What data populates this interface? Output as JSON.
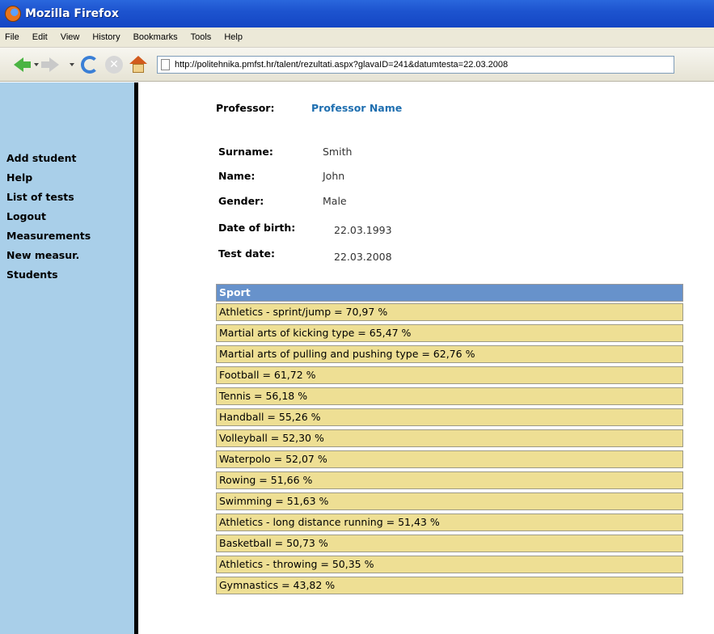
{
  "window": {
    "title": "Mozilla Firefox"
  },
  "menu": [
    "File",
    "Edit",
    "View",
    "History",
    "Bookmarks",
    "Tools",
    "Help"
  ],
  "toolbar": {
    "url": "http://politehnika.pmfst.hr/talent/rezultati.aspx?glavaID=241&datumtesta=22.03.2008",
    "icons": [
      "back-arrow-icon",
      "forward-arrow-icon",
      "reload-icon",
      "stop-icon",
      "home-icon",
      "page-icon"
    ]
  },
  "sidebar": {
    "items": [
      "Add student",
      "Help",
      "List of tests",
      "Logout",
      "Measurements",
      "New measur.",
      "Students"
    ]
  },
  "professor": {
    "label": "Professor:",
    "name": "Professor Name"
  },
  "student": {
    "surname_label": "Surname:",
    "surname": "Smith",
    "name_label": "Name:",
    "name": "John",
    "gender_label": "Gender:",
    "gender": "Male",
    "dob_label": "Date of birth:",
    "dob": "22.03.1993",
    "testdate_label": "Test date:",
    "testdate": "22.03.2008"
  },
  "sport_table": {
    "header": "Sport",
    "rows": [
      "Athletics - sprint/jump = 70,97 %",
      "Martial arts of kicking type = 65,47 %",
      "Martial arts of pulling and pushing type = 62,76 %",
      "Football = 61,72 %",
      "Tennis = 56,18 %",
      "Handball = 55,26 %",
      "Volleyball = 52,30 %",
      "Waterpolo = 52,07 %",
      "Rowing = 51,66 %",
      "Swimming = 51,63 %",
      "Athletics - long distance running = 51,43 %",
      "Basketball = 50,73 %",
      "Athletics - throwing = 50,35 %",
      "Gymnastics = 43,82 %"
    ]
  },
  "colors": {
    "sidebar_bg": "#a9cfe9",
    "table_header_bg": "#6792cb",
    "table_row_bg": "#eedf94",
    "professor_name": "#1f6fb0"
  }
}
